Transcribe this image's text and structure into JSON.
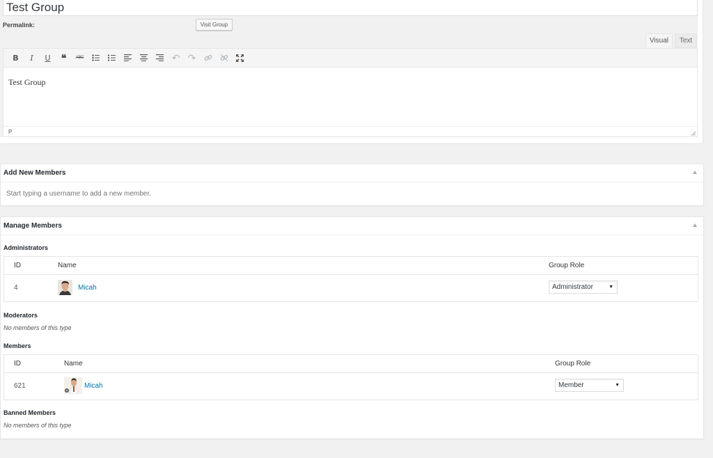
{
  "title": {
    "value": "Test Group"
  },
  "permalink": {
    "label": "Permalink:",
    "visit_button": "Visit Group"
  },
  "editor": {
    "tabs": [
      "Visual",
      "Text"
    ],
    "content": "Test Group",
    "status_path": "P",
    "toolbar": [
      {
        "icon": "bold-icon",
        "glyph": "B"
      },
      {
        "icon": "italic-icon",
        "glyph": "I"
      },
      {
        "icon": "underline-icon",
        "glyph": "U"
      },
      {
        "icon": "blockquote-icon",
        "glyph": "❝"
      },
      {
        "icon": "strikethrough-icon",
        "glyph": "ABC"
      },
      {
        "icon": "bulleted-list-icon",
        "glyph": "list"
      },
      {
        "icon": "numbered-list-icon",
        "glyph": "olist"
      },
      {
        "icon": "align-left-icon",
        "glyph": "aleft"
      },
      {
        "icon": "align-center-icon",
        "glyph": "acenter"
      },
      {
        "icon": "align-right-icon",
        "glyph": "aright"
      },
      {
        "icon": "undo-icon",
        "glyph": "↶"
      },
      {
        "icon": "redo-icon",
        "glyph": "↷"
      },
      {
        "icon": "insert-link-icon",
        "glyph": "link"
      },
      {
        "icon": "remove-link-icon",
        "glyph": "unlink"
      },
      {
        "icon": "fullscreen-icon",
        "glyph": "full"
      }
    ]
  },
  "add_members": {
    "title": "Add New Members",
    "placeholder": "Start typing a username to add a new member."
  },
  "manage_members": {
    "title": "Manage Members",
    "columns": {
      "id": "ID",
      "name": "Name",
      "role": "Group Role"
    },
    "administrators": {
      "title": "Administrators",
      "rows": [
        {
          "id": "4",
          "name": "Micah",
          "role": "Administrator"
        }
      ]
    },
    "moderators": {
      "title": "Moderators",
      "empty": "No members of this type"
    },
    "members": {
      "title": "Members",
      "rows": [
        {
          "id": "621",
          "name": "Micah",
          "role": "Member"
        }
      ]
    },
    "banned": {
      "title": "Banned Members",
      "empty": "No members of this type"
    }
  },
  "colors": {
    "link": "#0073aa",
    "background": "#f1f1f1"
  }
}
